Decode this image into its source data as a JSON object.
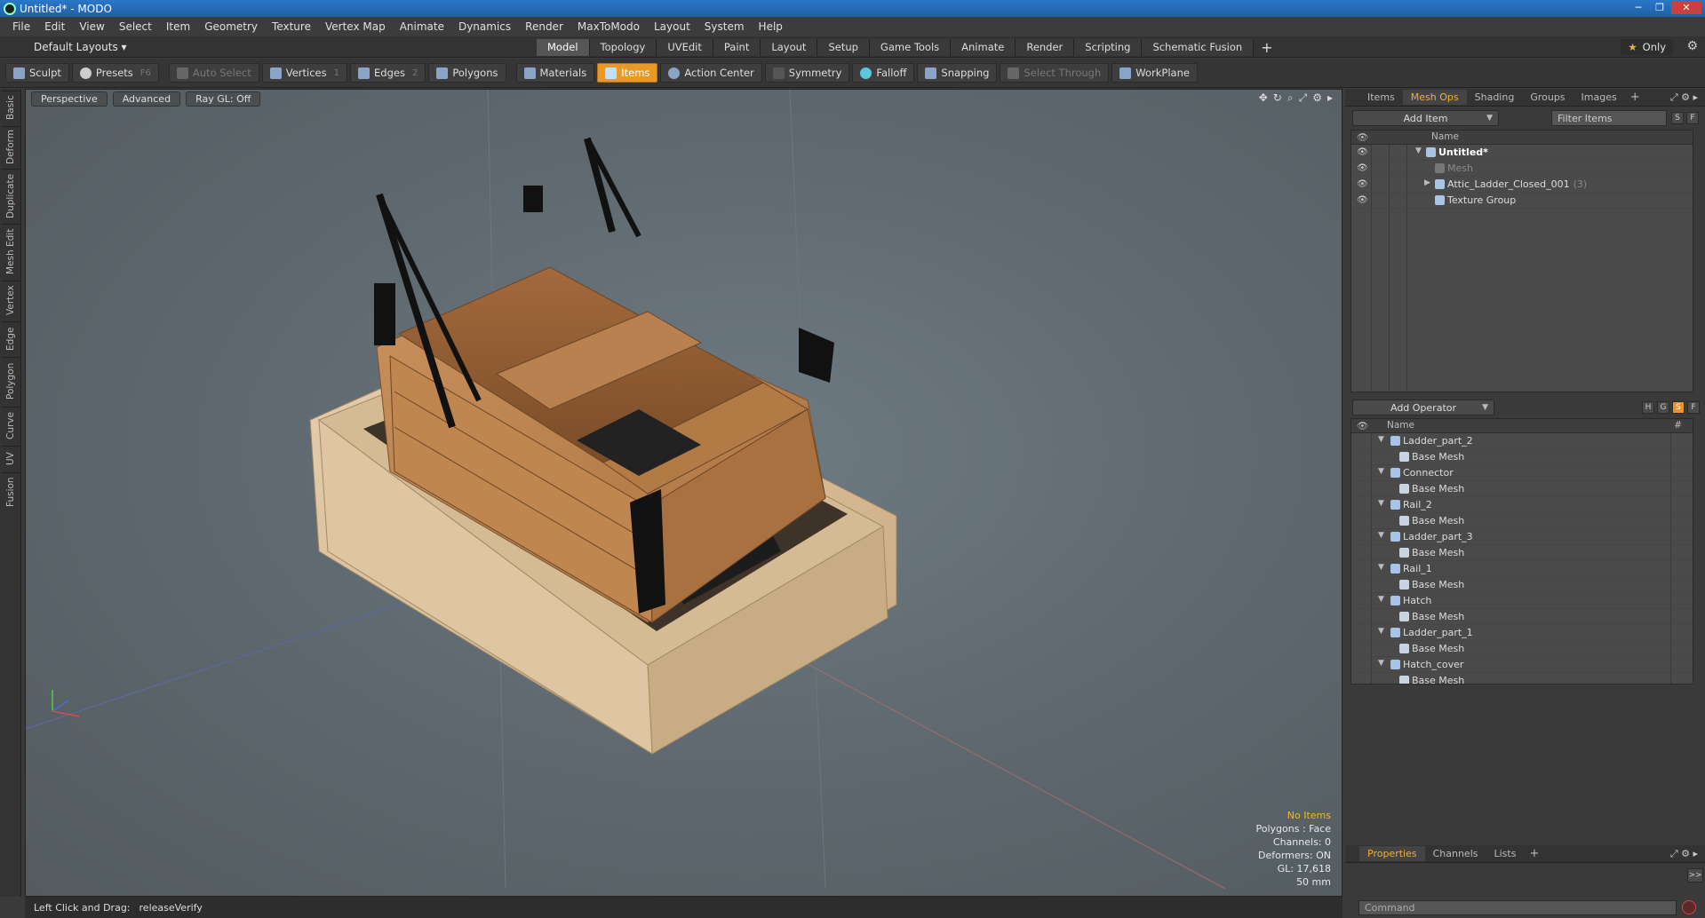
{
  "window": {
    "title": "Untitled* - MODO",
    "controls": [
      "─",
      "❐",
      "✕"
    ]
  },
  "menu": [
    "File",
    "Edit",
    "View",
    "Select",
    "Item",
    "Geometry",
    "Texture",
    "Vertex Map",
    "Animate",
    "Dynamics",
    "Render",
    "MaxToModo",
    "Layout",
    "System",
    "Help"
  ],
  "layout": {
    "selector": "Default Layouts ▾",
    "tabs": [
      "Model",
      "Topology",
      "UVEdit",
      "Paint",
      "Layout",
      "Setup",
      "Game Tools",
      "Animate",
      "Render",
      "Scripting",
      "Schematic Fusion"
    ],
    "active_tab": "Model",
    "add_tab": "+",
    "only_label": "Only"
  },
  "toolbar": {
    "sculpt": "Sculpt",
    "presets": "Presets",
    "presets_key": "F6",
    "auto_select": "Auto Select",
    "vertices": "Vertices",
    "vertices_key": "1",
    "edges": "Edges",
    "edges_key": "2",
    "polygons": "Polygons",
    "materials": "Materials",
    "items": "Items",
    "action_center": "Action Center",
    "symmetry": "Symmetry",
    "falloff": "Falloff",
    "snapping": "Snapping",
    "select_through": "Select Through",
    "workplane": "WorkPlane"
  },
  "left_tabs": [
    "Basic",
    "Deform",
    "Duplicate",
    "Mesh Edit",
    "Vertex",
    "Edge",
    "Polygon",
    "Curve",
    "UV",
    "Fusion"
  ],
  "viewport": {
    "view": "Perspective",
    "shading": "Advanced",
    "raygl": "Ray GL: Off",
    "info": {
      "no_items": "No Items",
      "polygons": "Polygons : Face",
      "channels": "Channels: 0",
      "deformers": "Deformers: ON",
      "gl": "GL: 17,618",
      "scale": "50 mm"
    }
  },
  "status": {
    "hint": "Left Click and Drag:",
    "action": "releaseVerify"
  },
  "items_panel": {
    "tabs": [
      "Items",
      "Mesh Ops",
      "Shading",
      "Groups",
      "Images"
    ],
    "active_tab": "Mesh Ops",
    "add_item": "Add Item",
    "filter": "Filter Items",
    "s_btn": "S",
    "f_btn": "F",
    "name_header": "Name",
    "rows": [
      {
        "label": "Untitled*"
      },
      {
        "label": "Mesh"
      },
      {
        "label": "Attic_Ladder_Closed_001",
        "count": "(3)"
      },
      {
        "label": "Texture Group"
      }
    ]
  },
  "mesh_ops_panel": {
    "add_operator": "Add Operator",
    "h_btn": "H",
    "g_btn": "G",
    "s_btn": "S",
    "f_btn": "F",
    "name_header": "Name",
    "hash_header": "#",
    "rows": [
      {
        "label": "Ladder_part_2",
        "child": "Base Mesh"
      },
      {
        "label": "Connector",
        "child": "Base Mesh"
      },
      {
        "label": "Rail_2",
        "child": "Base Mesh"
      },
      {
        "label": "Ladder_part_3",
        "child": "Base Mesh"
      },
      {
        "label": "Rail_1",
        "child": "Base Mesh"
      },
      {
        "label": "Hatch",
        "child": "Base Mesh"
      },
      {
        "label": "Ladder_part_1",
        "child": "Base Mesh"
      },
      {
        "label": "Hatch_cover",
        "child": "Base Mesh"
      }
    ]
  },
  "properties_panel": {
    "tabs": [
      "Properties",
      "Channels",
      "Lists"
    ],
    "active_tab": "Properties",
    "expand": ">>"
  },
  "command": {
    "placeholder": "Command"
  },
  "colors": {
    "accent": "#e8942a",
    "active_tab_text": "#f0b030",
    "title_bar": "#2a78c8"
  }
}
